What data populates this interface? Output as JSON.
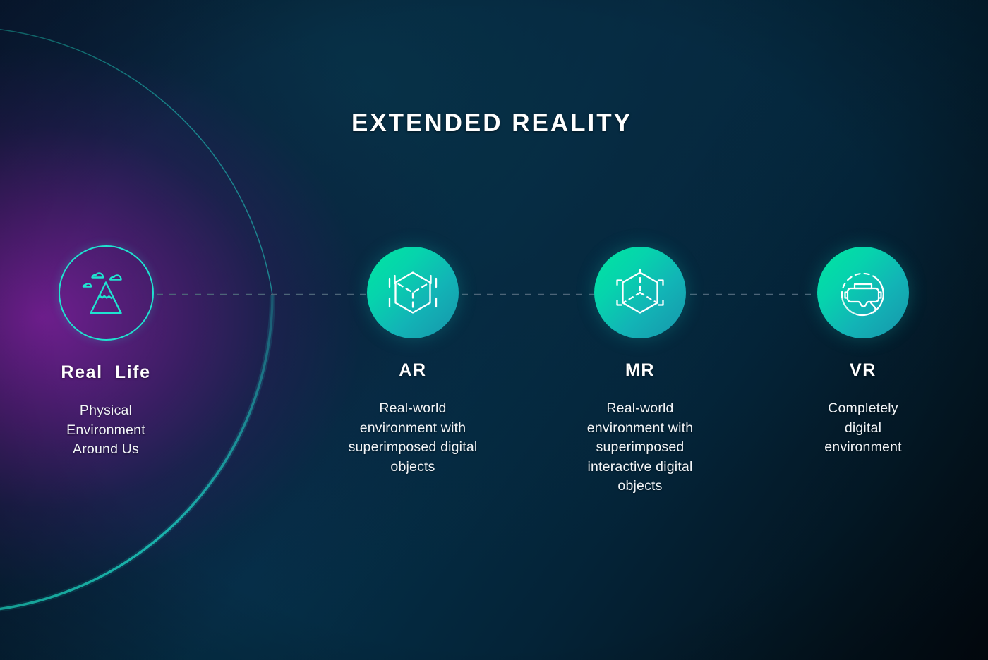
{
  "header": {
    "title": "EXTENDED REALITY"
  },
  "colors": {
    "accent_cyan": "#1FE3D0",
    "icon_gradient_start": "#00E6A0",
    "icon_gradient_end": "#1795AB",
    "purple_glow": "#5B1E79",
    "background_navy": "#05253D",
    "text_white": "#FFFFFF",
    "dashed_connector": "#4A6375"
  },
  "connector": {
    "style": "dashed",
    "name": "dashed-connector-line"
  },
  "nodes": [
    {
      "id": "real-life",
      "label": "Real  Life",
      "icon": "mountain-landscape-icon",
      "icon_style": "outline",
      "description": "Physical\nEnvironment\nAround Us"
    },
    {
      "id": "ar",
      "label": "AR",
      "icon": "ar-cube-scan-icon",
      "icon_style": "filled-gradient",
      "description": "Real-world\nenvironment  with\nsuperimposed digital\nobjects"
    },
    {
      "id": "mr",
      "label": "MR",
      "icon": "mr-hexagon-bracket-icon",
      "icon_style": "filled-gradient",
      "description": "Real-world\nenvironment with\nsuperimposed\ninteractive digital\nobjects"
    },
    {
      "id": "vr",
      "label": "VR",
      "icon": "vr-headset-icon",
      "icon_style": "filled-gradient",
      "description": "Completely\ndigital\nenvironment"
    }
  ]
}
